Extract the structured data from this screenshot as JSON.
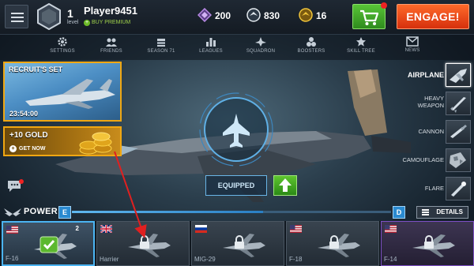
{
  "player": {
    "level": "1",
    "level_label": "level",
    "name": "Player9451",
    "buy_premium": "BUY PREMIUM"
  },
  "currencies": [
    {
      "icon": "shard-icon",
      "value": "200",
      "color": "#b98be6"
    },
    {
      "icon": "pilot-token-icon",
      "value": "830",
      "color": "#ffffff"
    },
    {
      "icon": "coin-icon",
      "value": "16",
      "color": "#f0c43a"
    }
  ],
  "top_actions": {
    "engage_label": "ENGAGE!",
    "cart_icon": "cart-icon"
  },
  "nav": [
    {
      "label": "SETTINGS",
      "icon": "gear-icon"
    },
    {
      "label": "FRIENDS",
      "icon": "friends-icon"
    },
    {
      "label": "SEASON 71",
      "icon": "season-icon"
    },
    {
      "label": "LEAGUES",
      "icon": "leagues-icon"
    },
    {
      "label": "SQUADRON",
      "icon": "squadron-icon"
    },
    {
      "label": "BOOSTERS",
      "icon": "boosters-icon"
    },
    {
      "label": "SKILL TREE",
      "icon": "skill-tree-icon"
    },
    {
      "label": "NEWS",
      "icon": "news-icon"
    }
  ],
  "promos": {
    "recruit": {
      "title": "RECRUIT'S SET",
      "timer": "23:54:00"
    },
    "gold": {
      "title": "+10 GOLD",
      "cta": "GET NOW"
    }
  },
  "slots": [
    {
      "label": "AIRPLANE",
      "icon": "airplane-slot-icon",
      "active": true
    },
    {
      "label": "HEAVY WEAPON",
      "icon": "missile-icon",
      "active": false
    },
    {
      "label": "CANNON",
      "icon": "cannon-icon",
      "active": false
    },
    {
      "label": "CAMOUFLAGE",
      "icon": "camouflage-icon",
      "active": false
    },
    {
      "label": "FLARE",
      "icon": "flare-icon",
      "active": false
    }
  ],
  "hangar": {
    "equipped_label": "EQUIPPED",
    "upgrade_icon": "upgrade-arrow-icon"
  },
  "power": {
    "label": "POWER",
    "grade_from": "E",
    "grade_to": "D",
    "progress": 0.6,
    "details_label": "DETAILS"
  },
  "aircraft": [
    {
      "name": "F-16",
      "flag": "us",
      "count": "2",
      "selected": true,
      "locked": false
    },
    {
      "name": "Harrier",
      "flag": "uk",
      "count": "",
      "selected": false,
      "locked": true
    },
    {
      "name": "MIG-29",
      "flag": "ru",
      "count": "",
      "selected": false,
      "locked": true
    },
    {
      "name": "F-18",
      "flag": "us",
      "count": "",
      "selected": false,
      "locked": true
    },
    {
      "name": "F-14",
      "flag": "us",
      "count": "",
      "selected": false,
      "locked": true
    }
  ],
  "colors": {
    "engage": "#e8481a",
    "cart": "#44ab2a",
    "promo_border": "#f0a712",
    "selection": "#4bb4f2",
    "annotation_arrow": "#e02020"
  }
}
